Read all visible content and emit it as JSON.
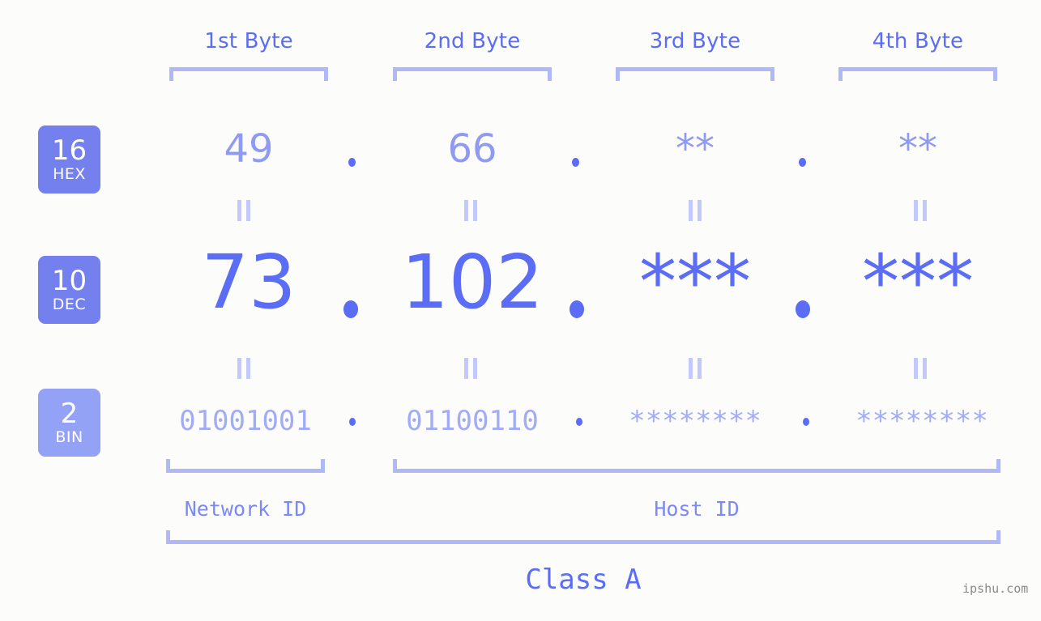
{
  "meta": {
    "background_color": "#fcfdfa",
    "accent_color": "#5b6cf5",
    "accent_light_color": "#b0b8f8",
    "badge_color": "#7480ee",
    "badge_color_light": "#93a2f5"
  },
  "byte_headers": [
    {
      "label": "1st Byte"
    },
    {
      "label": "2nd Byte"
    },
    {
      "label": "3rd Byte"
    },
    {
      "label": "4th Byte"
    }
  ],
  "rows": [
    {
      "base_number": "16",
      "base_name": "HEX",
      "values": [
        "49",
        "66",
        "**",
        "**"
      ],
      "separator": "."
    },
    {
      "base_number": "10",
      "base_name": "DEC",
      "values": [
        "73",
        "102",
        "***",
        "***"
      ],
      "separator": "."
    },
    {
      "base_number": "2",
      "base_name": "BIN",
      "values": [
        "01001001",
        "01100110",
        "********",
        "********"
      ],
      "separator": "."
    }
  ],
  "equals_symbol": "=",
  "segments": {
    "network_id": "Network ID",
    "host_id": "Host ID"
  },
  "class_label": "Class A",
  "watermark": "ipshu.com"
}
